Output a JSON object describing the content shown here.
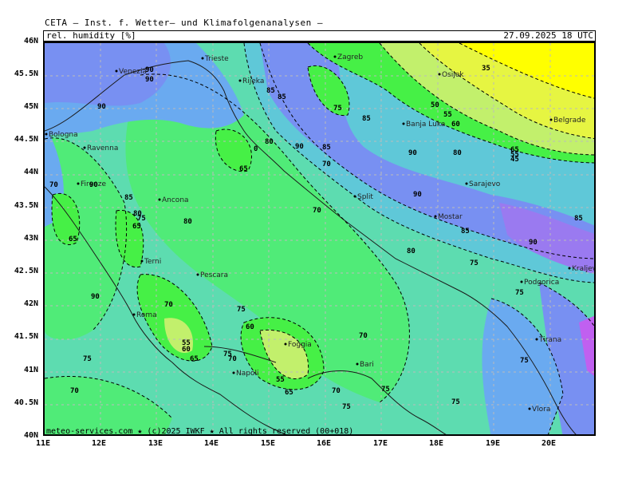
{
  "header": {
    "title": "CETA — Inst. f. Wetter— und Klimafolgenanalysen —",
    "variable": "rel. humidity [%]",
    "valid_time": "27.09.2025 18 UTC"
  },
  "footer": {
    "copyright": "meteo-services.com ★ (c)2025 IWKF ★ All rights reserved (00+018)"
  },
  "axes": {
    "lat_labels": [
      "46N",
      "45.5N",
      "45N",
      "44.5N",
      "44N",
      "43.5N",
      "43N",
      "42.5N",
      "42N",
      "41.5N",
      "41N",
      "40.5N",
      "40N"
    ],
    "lon_labels": [
      "11E",
      "12E",
      "13E",
      "14E",
      "15E",
      "16E",
      "17E",
      "18E",
      "19E",
      "20E"
    ]
  },
  "cities": [
    {
      "name": "Venezia"
    },
    {
      "name": "Trieste"
    },
    {
      "name": "Rijeka"
    },
    {
      "name": "Zagreb"
    },
    {
      "name": "Osijek"
    },
    {
      "name": "Bologna"
    },
    {
      "name": "Ravenna"
    },
    {
      "name": "Banja Luka"
    },
    {
      "name": "Belgrade"
    },
    {
      "name": "Firenze"
    },
    {
      "name": "Ancona"
    },
    {
      "name": "Split"
    },
    {
      "name": "Sarajevo"
    },
    {
      "name": "Mostar"
    },
    {
      "name": "Terni"
    },
    {
      "name": "Pescara"
    },
    {
      "name": "Kraljevo"
    },
    {
      "name": "Podgorica"
    },
    {
      "name": "Roma"
    },
    {
      "name": "Foggia"
    },
    {
      "name": "Tirana"
    },
    {
      "name": "Napoli"
    },
    {
      "name": "Bari"
    },
    {
      "name": "Vlora"
    }
  ],
  "contour_labels": [
    {
      "text": "90"
    },
    {
      "text": "90"
    },
    {
      "text": "90"
    },
    {
      "text": "80"
    },
    {
      "text": "85"
    },
    {
      "text": "85"
    },
    {
      "text": "85"
    },
    {
      "text": "75"
    },
    {
      "text": "50"
    },
    {
      "text": "55"
    },
    {
      "text": "60"
    },
    {
      "text": "90"
    },
    {
      "text": "80"
    },
    {
      "text": "35"
    },
    {
      "text": "65"
    },
    {
      "text": "55"
    },
    {
      "text": "45"
    },
    {
      "text": "90"
    },
    {
      "text": "85"
    },
    {
      "text": "70"
    },
    {
      "text": "65"
    },
    {
      "text": "0"
    },
    {
      "text": "70"
    },
    {
      "text": "90"
    },
    {
      "text": "85"
    },
    {
      "text": "70"
    },
    {
      "text": "80"
    },
    {
      "text": "75"
    },
    {
      "text": "65"
    },
    {
      "text": "90"
    },
    {
      "text": "85"
    },
    {
      "text": "65"
    },
    {
      "text": "80"
    },
    {
      "text": "90"
    },
    {
      "text": "85"
    },
    {
      "text": "75"
    },
    {
      "text": "80"
    },
    {
      "text": "70"
    },
    {
      "text": "70"
    },
    {
      "text": "75"
    },
    {
      "text": "60"
    },
    {
      "text": "55"
    },
    {
      "text": "60"
    },
    {
      "text": "65"
    },
    {
      "text": "70"
    },
    {
      "text": "75"
    },
    {
      "text": "55"
    },
    {
      "text": "65"
    },
    {
      "text": "70"
    },
    {
      "text": "75"
    },
    {
      "text": "75"
    },
    {
      "text": "70"
    },
    {
      "text": "75"
    },
    {
      "text": "75"
    },
    {
      "text": "90"
    },
    {
      "text": "75"
    },
    {
      "text": "75"
    }
  ],
  "colors": {
    "rh_35": "#ffff00",
    "rh_45": "#e6f542",
    "rh_55": "#c2f06c",
    "rh_65": "#46f046",
    "rh_70": "#50eb78",
    "rh_75": "#5ddcb0",
    "rh_80": "#5fc8d8",
    "rh_85": "#6aaaf0",
    "rh_90": "#7890f2",
    "rh_95": "#9a7af0",
    "rh_100": "#c060f0"
  }
}
